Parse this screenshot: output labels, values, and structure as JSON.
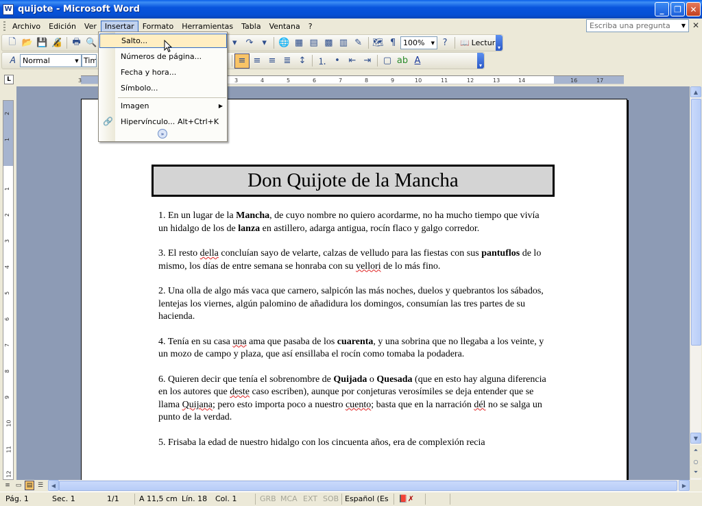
{
  "window": {
    "title": "quijote - Microsoft Word",
    "icon_label": "W",
    "controls": {
      "minimize": "_",
      "maximize": "❐",
      "close": "✕"
    }
  },
  "menubar": {
    "items": [
      "Archivo",
      "Edición",
      "Ver",
      "Insertar",
      "Formato",
      "Herramientas",
      "Tabla",
      "Ventana",
      "?"
    ],
    "active": "Insertar",
    "help_placeholder": "Escriba una pregunta",
    "doc_close": "✕"
  },
  "insert_menu": {
    "items": [
      {
        "label": "Salto...",
        "shortcut": "",
        "highlighted": true
      },
      {
        "label": "Números de página...",
        "shortcut": ""
      },
      {
        "label": "Fecha y hora...",
        "shortcut": ""
      },
      {
        "label": "Símbolo...",
        "shortcut": ""
      },
      {
        "label": "Imagen",
        "shortcut": "",
        "submenu": true
      },
      {
        "label": "Hipervínculo...",
        "shortcut": "Alt+Ctrl+K"
      }
    ],
    "expand_glyph": "»"
  },
  "standard_toolbar": {
    "zoom": "100%",
    "reading_label": "Lectura"
  },
  "format_toolbar": {
    "style": "Normal",
    "font": "Tim"
  },
  "ruler": {
    "ticks": [
      "3",
      "1",
      "2",
      "3",
      "4",
      "5",
      "6",
      "7",
      "8",
      "9",
      "10",
      "11",
      "12",
      "13",
      "14",
      "16",
      "17"
    ],
    "vticks": [
      "2",
      "1",
      "1",
      "2",
      "3",
      "4",
      "5",
      "6",
      "7",
      "8",
      "9",
      "10",
      "11",
      "12"
    ]
  },
  "document": {
    "title": "Don Quijote de la Mancha",
    "paragraphs": [
      [
        {
          "t": "1. En un lugar de la "
        },
        {
          "t": "Mancha",
          "b": true
        },
        {
          "t": ", de cuyo nombre no quiero acordarme, no ha mucho tiempo que vivía un hidalgo de los de "
        },
        {
          "t": "lanza",
          "b": true
        },
        {
          "t": " en astillero, adarga antigua, rocín flaco y galgo corredor."
        }
      ],
      [
        {
          "t": "3. El resto "
        },
        {
          "t": "della",
          "sq": true
        },
        {
          "t": " concluían sayo de velarte, calzas de velludo para las fiestas con sus "
        },
        {
          "t": "pantuflos",
          "b": true
        },
        {
          "t": " de lo mismo, los días de entre semana se honraba con su "
        },
        {
          "t": "vellori",
          "sq": true
        },
        {
          "t": " de lo más fino."
        }
      ],
      [
        {
          "t": "2. Una olla de algo más vaca que carnero, salpicón las más noches, duelos y quebrantos los sábados, lentejas los viernes, algún palomino de añadidura los domingos, consumían las tres partes de su hacienda."
        }
      ],
      [
        {
          "t": "4. Tenía en su casa "
        },
        {
          "t": "una",
          "sq": true
        },
        {
          "t": " ama que pasaba de los "
        },
        {
          "t": "cuarenta",
          "b": true
        },
        {
          "t": ", y una sobrina que no llegaba a los veinte, y un mozo de campo y plaza, que así ensillaba el rocín como tomaba la podadera."
        }
      ],
      [
        {
          "t": "6. Quieren decir que tenía el sobrenombre de "
        },
        {
          "t": "Quijada",
          "b": true
        },
        {
          "t": " o "
        },
        {
          "t": "Quesada",
          "b": true
        },
        {
          "t": " (que en esto hay alguna diferencia en los autores que "
        },
        {
          "t": "deste",
          "sq": true
        },
        {
          "t": " caso escriben), aunque por conjeturas verosímiles se deja entender que se llama "
        },
        {
          "t": "Quijana",
          "sq": true
        },
        {
          "t": "; pero esto importa poco a nuestro "
        },
        {
          "t": "cuento",
          "sq": true
        },
        {
          "t": "; basta que en la narración "
        },
        {
          "t": "dél",
          "sq": true
        },
        {
          "t": " no se salga un punto de la verdad."
        }
      ],
      [
        {
          "t": "5. Frisaba la edad de nuestro hidalgo con los cincuenta años, era de complexión recia"
        }
      ]
    ]
  },
  "statusbar": {
    "page": "Pág. 1",
    "section": "Sec. 1",
    "page_count": "1/1",
    "position": "A 11,5 cm",
    "line": "Lín. 18",
    "column": "Col. 1",
    "grb": "GRB",
    "mca": "MCA",
    "ext": "EXT",
    "sob": "SOB",
    "language": "Español (Es"
  }
}
